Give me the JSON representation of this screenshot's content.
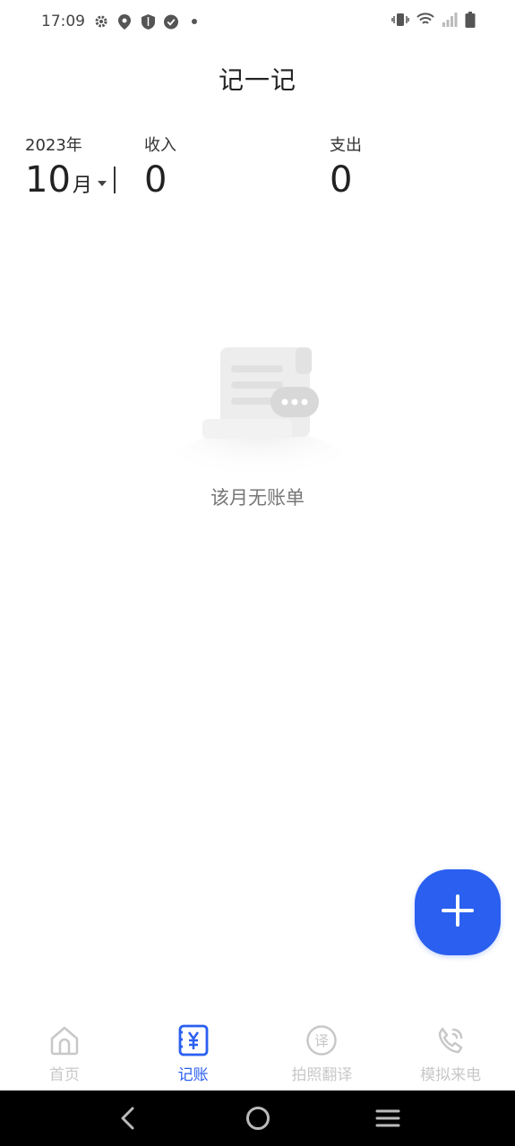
{
  "status_bar": {
    "time": "17:09",
    "left_icons": [
      "gear-icon",
      "location-icon",
      "shield-icon",
      "check-shield-icon",
      "dot-icon"
    ],
    "right_icons": [
      "vibrate-icon",
      "wifi-icon",
      "signal-icon",
      "battery-icon"
    ]
  },
  "header": {
    "title": "记一记"
  },
  "summary": {
    "year": "2023年",
    "month_number": "10",
    "month_unit": "月",
    "income_label": "收入",
    "income_value": "0",
    "expense_label": "支出",
    "expense_value": "0"
  },
  "empty_state": {
    "message": "该月无账单"
  },
  "fab": {
    "icon": "plus-icon",
    "color": "#2a5ff0"
  },
  "bottom_nav": {
    "active_color": "#2a5ff0",
    "inactive_color": "#c8c8c8",
    "items": [
      {
        "label": "首页",
        "icon": "home-icon",
        "active": false
      },
      {
        "label": "记账",
        "icon": "ledger-yen-icon",
        "active": true
      },
      {
        "label": "拍照翻译",
        "icon": "translate-icon",
        "active": false
      },
      {
        "label": "模拟来电",
        "icon": "phone-call-icon",
        "active": false
      }
    ]
  },
  "system_nav": {
    "buttons": [
      "back-icon",
      "home-circle-icon",
      "menu-icon"
    ]
  }
}
